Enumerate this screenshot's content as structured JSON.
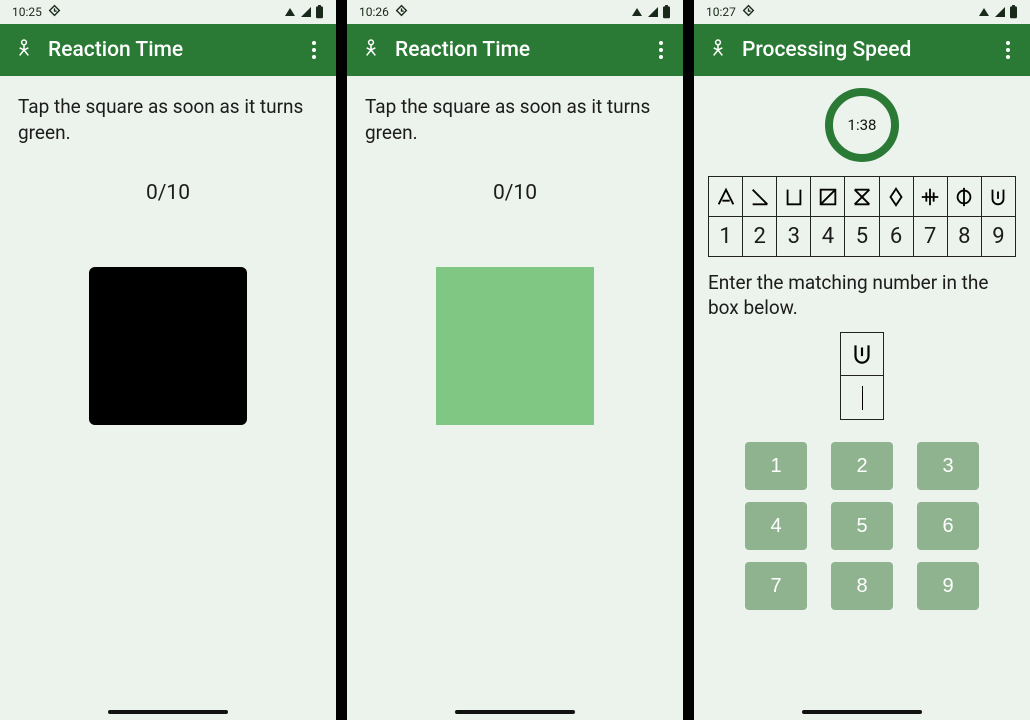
{
  "screens": [
    {
      "status": {
        "time": "10:25"
      },
      "header": {
        "title": "Reaction Time"
      },
      "instruction": "Tap the square as soon as it turns green.",
      "progress": "0/10",
      "square_color": "black"
    },
    {
      "status": {
        "time": "10:26"
      },
      "header": {
        "title": "Reaction Time"
      },
      "instruction": "Tap the square as soon as it turns green.",
      "progress": "0/10",
      "square_color": "green"
    },
    {
      "status": {
        "time": "10:27"
      },
      "header": {
        "title": "Processing Speed"
      },
      "timer": "1:38",
      "key_numbers": [
        "1",
        "2",
        "3",
        "4",
        "5",
        "6",
        "7",
        "8",
        "9"
      ],
      "prompt": "Enter the matching number in the box below.",
      "target_symbol_index": 8,
      "numpad": [
        "1",
        "2",
        "3",
        "4",
        "5",
        "6",
        "7",
        "8",
        "9"
      ]
    }
  ],
  "colors": {
    "brand": "#2a7a36",
    "key_bg": "#8fb38f",
    "square_green": "#81c784"
  }
}
